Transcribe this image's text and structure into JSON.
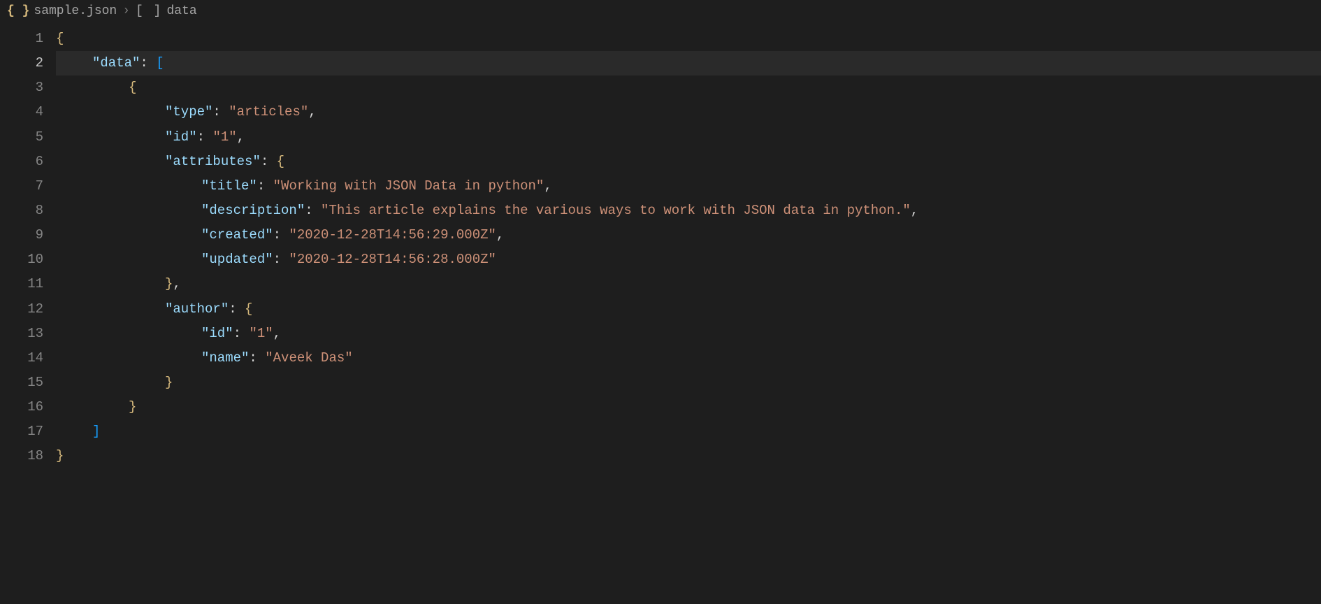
{
  "breadcrumb": {
    "file_icon_label": "{ }",
    "filename": "sample.json",
    "separator": "›",
    "array_icon_label": "[ ]",
    "path_item": "data"
  },
  "editor": {
    "active_line": 2,
    "lines": [
      {
        "n": 1,
        "indent": 0,
        "tokens": [
          [
            "brace",
            "{"
          ]
        ]
      },
      {
        "n": 2,
        "indent": 1,
        "tokens": [
          [
            "keyq",
            "\""
          ],
          [
            "key",
            "data"
          ],
          [
            "keyq",
            "\""
          ],
          [
            "punc",
            ":"
          ],
          [
            "space",
            " "
          ],
          [
            "bracket",
            "["
          ]
        ]
      },
      {
        "n": 3,
        "indent": 2,
        "tokens": [
          [
            "brace",
            "{"
          ]
        ]
      },
      {
        "n": 4,
        "indent": 3,
        "tokens": [
          [
            "keyq",
            "\""
          ],
          [
            "key",
            "type"
          ],
          [
            "keyq",
            "\""
          ],
          [
            "punc",
            ":"
          ],
          [
            "space",
            " "
          ],
          [
            "str",
            "\"articles\""
          ],
          [
            "punc",
            ","
          ]
        ]
      },
      {
        "n": 5,
        "indent": 3,
        "tokens": [
          [
            "keyq",
            "\""
          ],
          [
            "key",
            "id"
          ],
          [
            "keyq",
            "\""
          ],
          [
            "punc",
            ":"
          ],
          [
            "space",
            " "
          ],
          [
            "str",
            "\"1\""
          ],
          [
            "punc",
            ","
          ]
        ]
      },
      {
        "n": 6,
        "indent": 3,
        "tokens": [
          [
            "keyq",
            "\""
          ],
          [
            "key",
            "attributes"
          ],
          [
            "keyq",
            "\""
          ],
          [
            "punc",
            ":"
          ],
          [
            "space",
            " "
          ],
          [
            "brace",
            "{"
          ]
        ]
      },
      {
        "n": 7,
        "indent": 4,
        "tokens": [
          [
            "keyq",
            "\""
          ],
          [
            "key",
            "title"
          ],
          [
            "keyq",
            "\""
          ],
          [
            "punc",
            ":"
          ],
          [
            "space",
            " "
          ],
          [
            "str",
            "\"Working with JSON Data in python\""
          ],
          [
            "punc",
            ","
          ]
        ]
      },
      {
        "n": 8,
        "indent": 4,
        "tokens": [
          [
            "keyq",
            "\""
          ],
          [
            "key",
            "description"
          ],
          [
            "keyq",
            "\""
          ],
          [
            "punc",
            ":"
          ],
          [
            "space",
            " "
          ],
          [
            "str",
            "\"This article explains the various ways to work with JSON data in python.\""
          ],
          [
            "punc",
            ","
          ]
        ]
      },
      {
        "n": 9,
        "indent": 4,
        "tokens": [
          [
            "keyq",
            "\""
          ],
          [
            "key",
            "created"
          ],
          [
            "keyq",
            "\""
          ],
          [
            "punc",
            ":"
          ],
          [
            "space",
            " "
          ],
          [
            "str",
            "\"2020-12-28T14:56:29.000Z\""
          ],
          [
            "punc",
            ","
          ]
        ]
      },
      {
        "n": 10,
        "indent": 4,
        "tokens": [
          [
            "keyq",
            "\""
          ],
          [
            "key",
            "updated"
          ],
          [
            "keyq",
            "\""
          ],
          [
            "punc",
            ":"
          ],
          [
            "space",
            " "
          ],
          [
            "str",
            "\"2020-12-28T14:56:28.000Z\""
          ]
        ]
      },
      {
        "n": 11,
        "indent": 3,
        "tokens": [
          [
            "brace",
            "}"
          ],
          [
            "punc",
            ","
          ]
        ]
      },
      {
        "n": 12,
        "indent": 3,
        "tokens": [
          [
            "keyq",
            "\""
          ],
          [
            "key",
            "author"
          ],
          [
            "keyq",
            "\""
          ],
          [
            "punc",
            ":"
          ],
          [
            "space",
            " "
          ],
          [
            "brace",
            "{"
          ]
        ]
      },
      {
        "n": 13,
        "indent": 4,
        "tokens": [
          [
            "keyq",
            "\""
          ],
          [
            "key",
            "id"
          ],
          [
            "keyq",
            "\""
          ],
          [
            "punc",
            ":"
          ],
          [
            "space",
            " "
          ],
          [
            "str",
            "\"1\""
          ],
          [
            "punc",
            ","
          ]
        ]
      },
      {
        "n": 14,
        "indent": 4,
        "tokens": [
          [
            "keyq",
            "\""
          ],
          [
            "key",
            "name"
          ],
          [
            "keyq",
            "\""
          ],
          [
            "punc",
            ":"
          ],
          [
            "space",
            " "
          ],
          [
            "str",
            "\"Aveek Das\""
          ]
        ]
      },
      {
        "n": 15,
        "indent": 3,
        "tokens": [
          [
            "brace",
            "}"
          ]
        ]
      },
      {
        "n": 16,
        "indent": 2,
        "tokens": [
          [
            "brace",
            "}"
          ]
        ]
      },
      {
        "n": 17,
        "indent": 1,
        "tokens": [
          [
            "bracket",
            "]"
          ]
        ]
      },
      {
        "n": 18,
        "indent": 0,
        "tokens": [
          [
            "brace",
            "}"
          ]
        ]
      }
    ]
  }
}
